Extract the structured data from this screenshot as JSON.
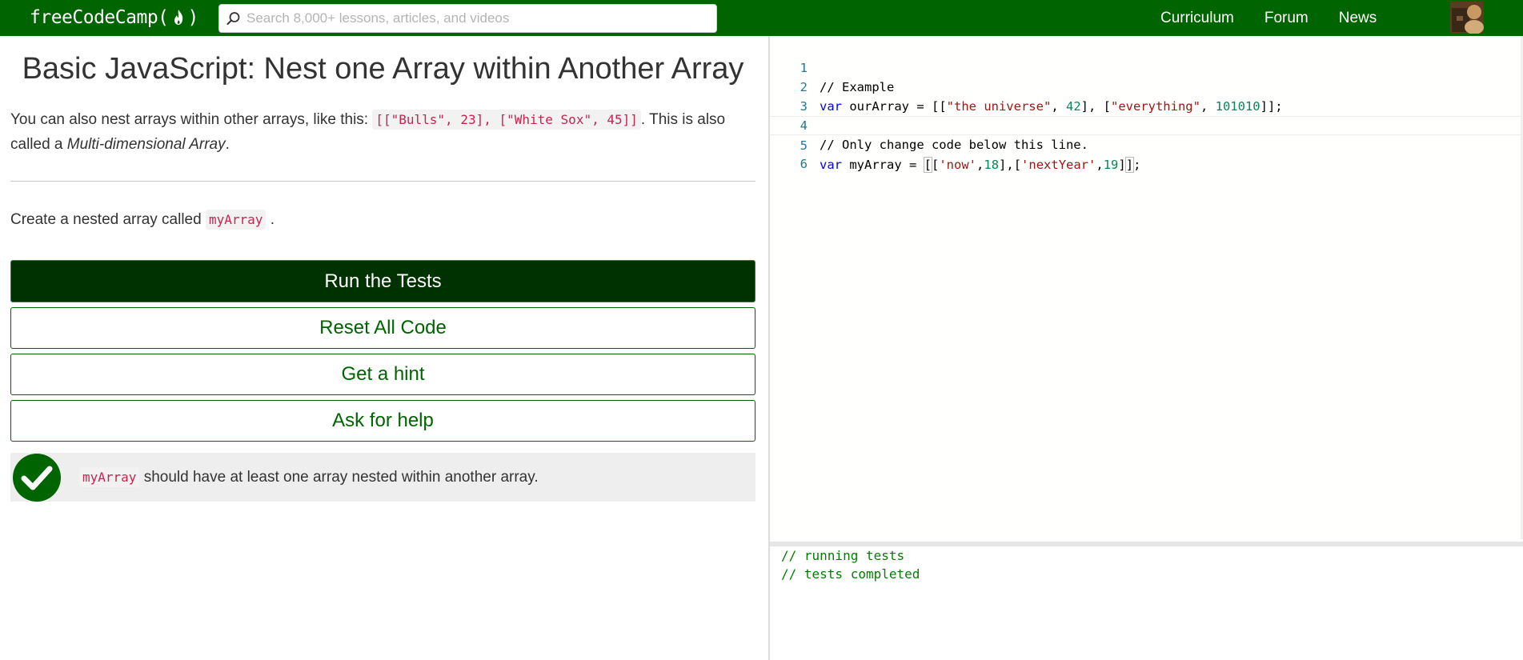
{
  "navbar": {
    "logo_left": "freeCodeCamp(",
    "logo_right": ")",
    "search_placeholder": "Search 8,000+ lessons, articles, and videos",
    "links": [
      "Curriculum",
      "Forum",
      "News"
    ]
  },
  "lesson": {
    "title": "Basic JavaScript: Nest one Array within Another Array",
    "para1_before": "You can also nest arrays within other arrays, like this: ",
    "para1_code": "[[\"Bulls\", 23], [\"White Sox\", 45]]",
    "para1_after": ". This is also called a ",
    "para1_em": "Multi-dimensional Array",
    "para1_end": ".",
    "para2_before": "Create a nested array called ",
    "para2_code": "myArray",
    "para2_after": "."
  },
  "buttons": {
    "run": "Run the Tests",
    "reset": "Reset All Code",
    "hint": "Get a hint",
    "help": "Ask for help"
  },
  "test": {
    "code": "myArray",
    "text": " should have at least one array nested within another array.",
    "passed": true
  },
  "editor": {
    "line_numbers": [
      "1",
      "2",
      "3",
      "4",
      "5",
      "6"
    ],
    "lines": [
      "// Example",
      "var ourArray = [[\"the universe\", 42], [\"everything\", 101010]];",
      "",
      "// Only change code below this line.",
      "var myArray = [['now',18],['nextYear',19]];",
      ""
    ],
    "current_line": 5
  },
  "output": {
    "lines": [
      "// running tests",
      "// tests completed"
    ]
  },
  "colors": {
    "nav_bg": "#006400",
    "run_button_bg": "#003100",
    "accent": "#006400",
    "code_inline": "#c7254e",
    "comment": "#008000",
    "keyword": "#0000ff",
    "string": "#a31515",
    "number": "#098658"
  },
  "icons": [
    "flame-icon",
    "search-icon",
    "avatar",
    "check-circle-icon"
  ]
}
